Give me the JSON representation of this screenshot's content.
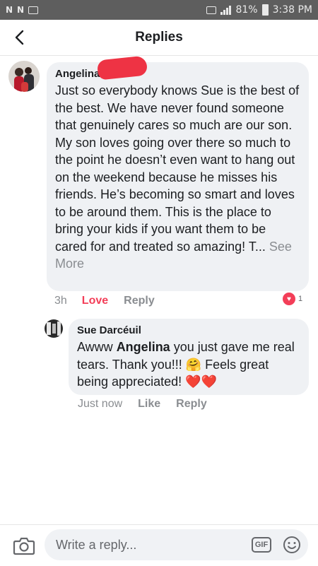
{
  "status_bar": {
    "left_icons": [
      "N",
      "N",
      "image-icon"
    ],
    "battery_text": "81%",
    "time": "3:38 PM"
  },
  "header": {
    "title": "Replies"
  },
  "comments": [
    {
      "author": "Angelina",
      "text": "Just so everybody knows Sue is the best of the best. We have never found someone that genuinely cares so much are our son. My son loves going over there so much to the point he doesn’t even want to hang out on the weekend because he misses his friends. He’s becoming so smart and loves to be around them. This is the place to bring your kids if you want them to be cared for and treated so amazing! T...",
      "see_more": "See More",
      "time": "3h",
      "react_label": "Love",
      "reply_label": "Reply",
      "reaction_count": "1"
    },
    {
      "author": "Sue Darcéuil",
      "text_before": "Awww ",
      "mention": "Angelina",
      "text_after": " you just gave me real tears. Thank you!!! 🤗 Feels great being appreciated! ❤️❤️",
      "time": "Just now",
      "react_label": "Like",
      "reply_label": "Reply"
    }
  ],
  "composer": {
    "placeholder": "Write a reply...",
    "gif_label": "GIF"
  },
  "colors": {
    "love": "#f33e58",
    "bubble": "#eff1f4",
    "status_bar": "#5e5e5e"
  }
}
